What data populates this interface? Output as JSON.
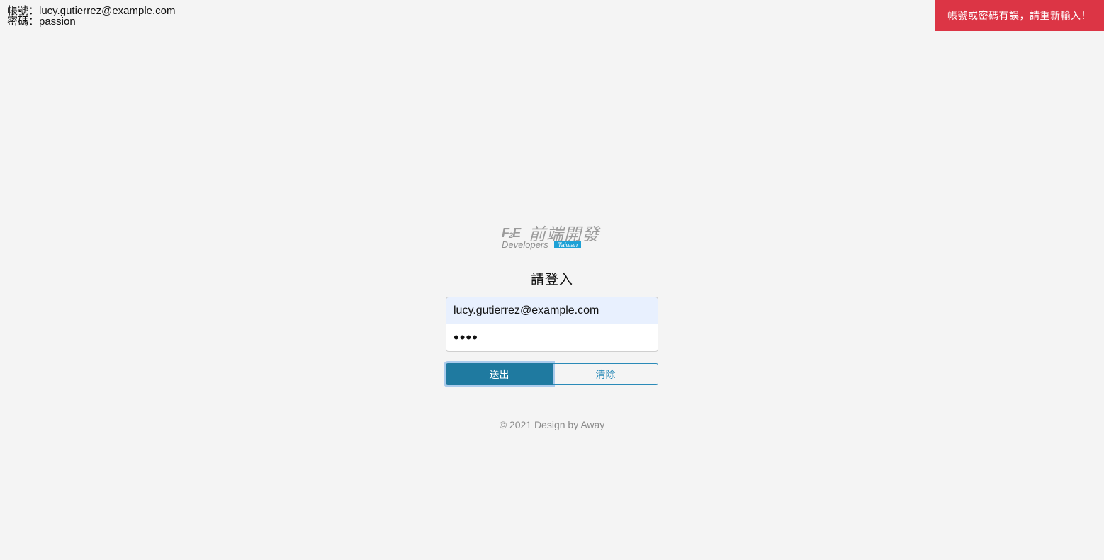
{
  "hint": {
    "account_line": "帳號：lucy.gutierrez@example.com",
    "password_line": "密碼：passion"
  },
  "toast": {
    "message": "帳號或密碼有誤，請重新輸入！",
    "color": "#dc3545"
  },
  "logo": {
    "f2e": "F",
    "f2e_sub": "2",
    "f2e_tail": "E",
    "chinese": "前端開發",
    "developers": "Developers",
    "taiwan": "Taiwan"
  },
  "login": {
    "title": "請登入",
    "email_value": "lucy.gutierrez@example.com",
    "password_value": "abcd",
    "submit_label": "送出",
    "clear_label": "清除"
  },
  "footer": {
    "text": "© 2021 Design by Away"
  },
  "colors": {
    "accent": "#1f7aa0",
    "background": "#f4f4f4"
  }
}
